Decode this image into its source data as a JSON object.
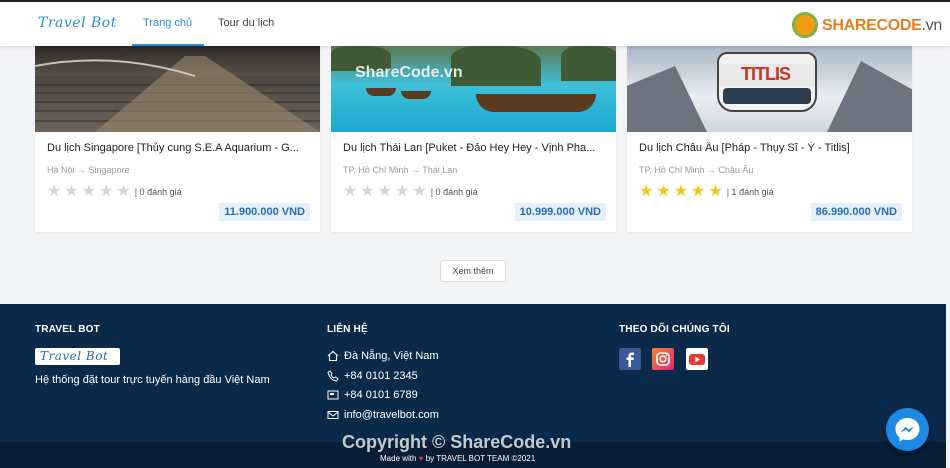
{
  "header": {
    "brand": "Travel Bot",
    "nav": [
      {
        "label": "Trang chủ",
        "active": true
      },
      {
        "label": "Tour du lịch",
        "active": false
      }
    ],
    "watermark_logo": {
      "brand": "SHARECODE",
      "suffix": ".vn"
    }
  },
  "watermark_top": "ShareCode.vn",
  "tours": [
    {
      "title": "Du lịch Singapore [Thủy cung S.E.A Aquarium - G...",
      "from": "Hà Nội",
      "to": "Singapore",
      "rating": 0,
      "max_rating": 5,
      "reviews": "| 0 đánh giá",
      "price": "11.900.000 VND"
    },
    {
      "title": "Du lịch Thái Lan [Puket - Đảo Hey Hey - Vịnh Pha...",
      "from": "TP. Hồ Chí Minh",
      "to": "Thái Lan",
      "rating": 0,
      "max_rating": 5,
      "reviews": "| 0 đánh giá",
      "price": "10.999.000 VND"
    },
    {
      "title": "Du lịch Châu Âu [Pháp - Thụy Sĩ - Ý - Titlis]",
      "from": "TP. Hồ Chí Minh",
      "to": "Châu Âu",
      "rating": 5,
      "max_rating": 5,
      "reviews": "| 1 đánh giá",
      "price": "86.990.000 VND",
      "image_text": "TITLIS"
    }
  ],
  "see_more": "Xem thêm",
  "footer": {
    "about": {
      "heading": "TRAVEL BOT",
      "logo": "Travel Bot",
      "slogan": "Hệ thống đặt tour trực tuyến hàng đầu Việt Nam"
    },
    "contact": {
      "heading": "LIÊN HỆ",
      "items": [
        {
          "icon": "home-icon",
          "text": "Đà Nẵng, Việt Nam"
        },
        {
          "icon": "phone-icon",
          "text": "+84 0101 2345"
        },
        {
          "icon": "fax-icon",
          "text": "+84 0101 6789"
        },
        {
          "icon": "mail-icon",
          "text": "info@travelbot.com"
        }
      ]
    },
    "social": {
      "heading": "THEO DÕI CHÚNG TÔI",
      "items": [
        "facebook-icon",
        "instagram-icon",
        "youtube-icon"
      ]
    },
    "copyright_watermark": "Copyright © ShareCode.vn",
    "made_with_prefix": "Made with",
    "made_with_suffix": "by TRAVEL BOT TEAM ©2021"
  },
  "colors": {
    "accent": "#2a8fd6",
    "footer_bg": "#0b2a4a",
    "star_on": "#f5c518",
    "star_off": "#d6d6d6",
    "price_bg": "#e4f0fb"
  }
}
